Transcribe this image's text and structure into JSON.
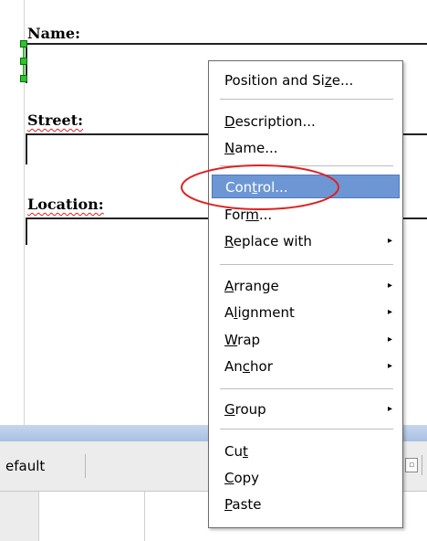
{
  "form": {
    "name_label": "Name:",
    "street_label": "Street:",
    "location_label": "Location:"
  },
  "statusbar": {
    "style_name": "efault"
  },
  "context_menu": {
    "items": [
      {
        "pre": "Position and Si",
        "u": "z",
        "post": "e...",
        "submenu": false
      },
      {
        "pre": "",
        "u": "D",
        "post": "escription...",
        "submenu": false
      },
      {
        "pre": "",
        "u": "N",
        "post": "ame...",
        "submenu": false
      },
      {
        "pre": "Con",
        "u": "t",
        "post": "rol...",
        "submenu": false,
        "highlighted": true
      },
      {
        "pre": "For",
        "u": "m",
        "post": "...",
        "submenu": false
      },
      {
        "pre": "",
        "u": "R",
        "post": "eplace with",
        "submenu": true
      },
      {
        "pre": "",
        "u": "A",
        "post": "rrange",
        "submenu": true
      },
      {
        "pre": "A",
        "u": "l",
        "post": "ignment",
        "submenu": true
      },
      {
        "pre": "",
        "u": "W",
        "post": "rap",
        "submenu": true
      },
      {
        "pre": "An",
        "u": "c",
        "post": "hor",
        "submenu": true
      },
      {
        "pre": "",
        "u": "G",
        "post": "roup",
        "submenu": true
      },
      {
        "pre": "Cu",
        "u": "t",
        "post": "",
        "submenu": false
      },
      {
        "pre": "",
        "u": "C",
        "post": "opy",
        "submenu": false
      },
      {
        "pre": "",
        "u": "P",
        "post": "aste",
        "submenu": false
      }
    ],
    "submenu_arrow": "▸"
  },
  "colors": {
    "highlight": "#6d97d4",
    "annotation": "#e02020",
    "handle": "#2ec42e"
  }
}
